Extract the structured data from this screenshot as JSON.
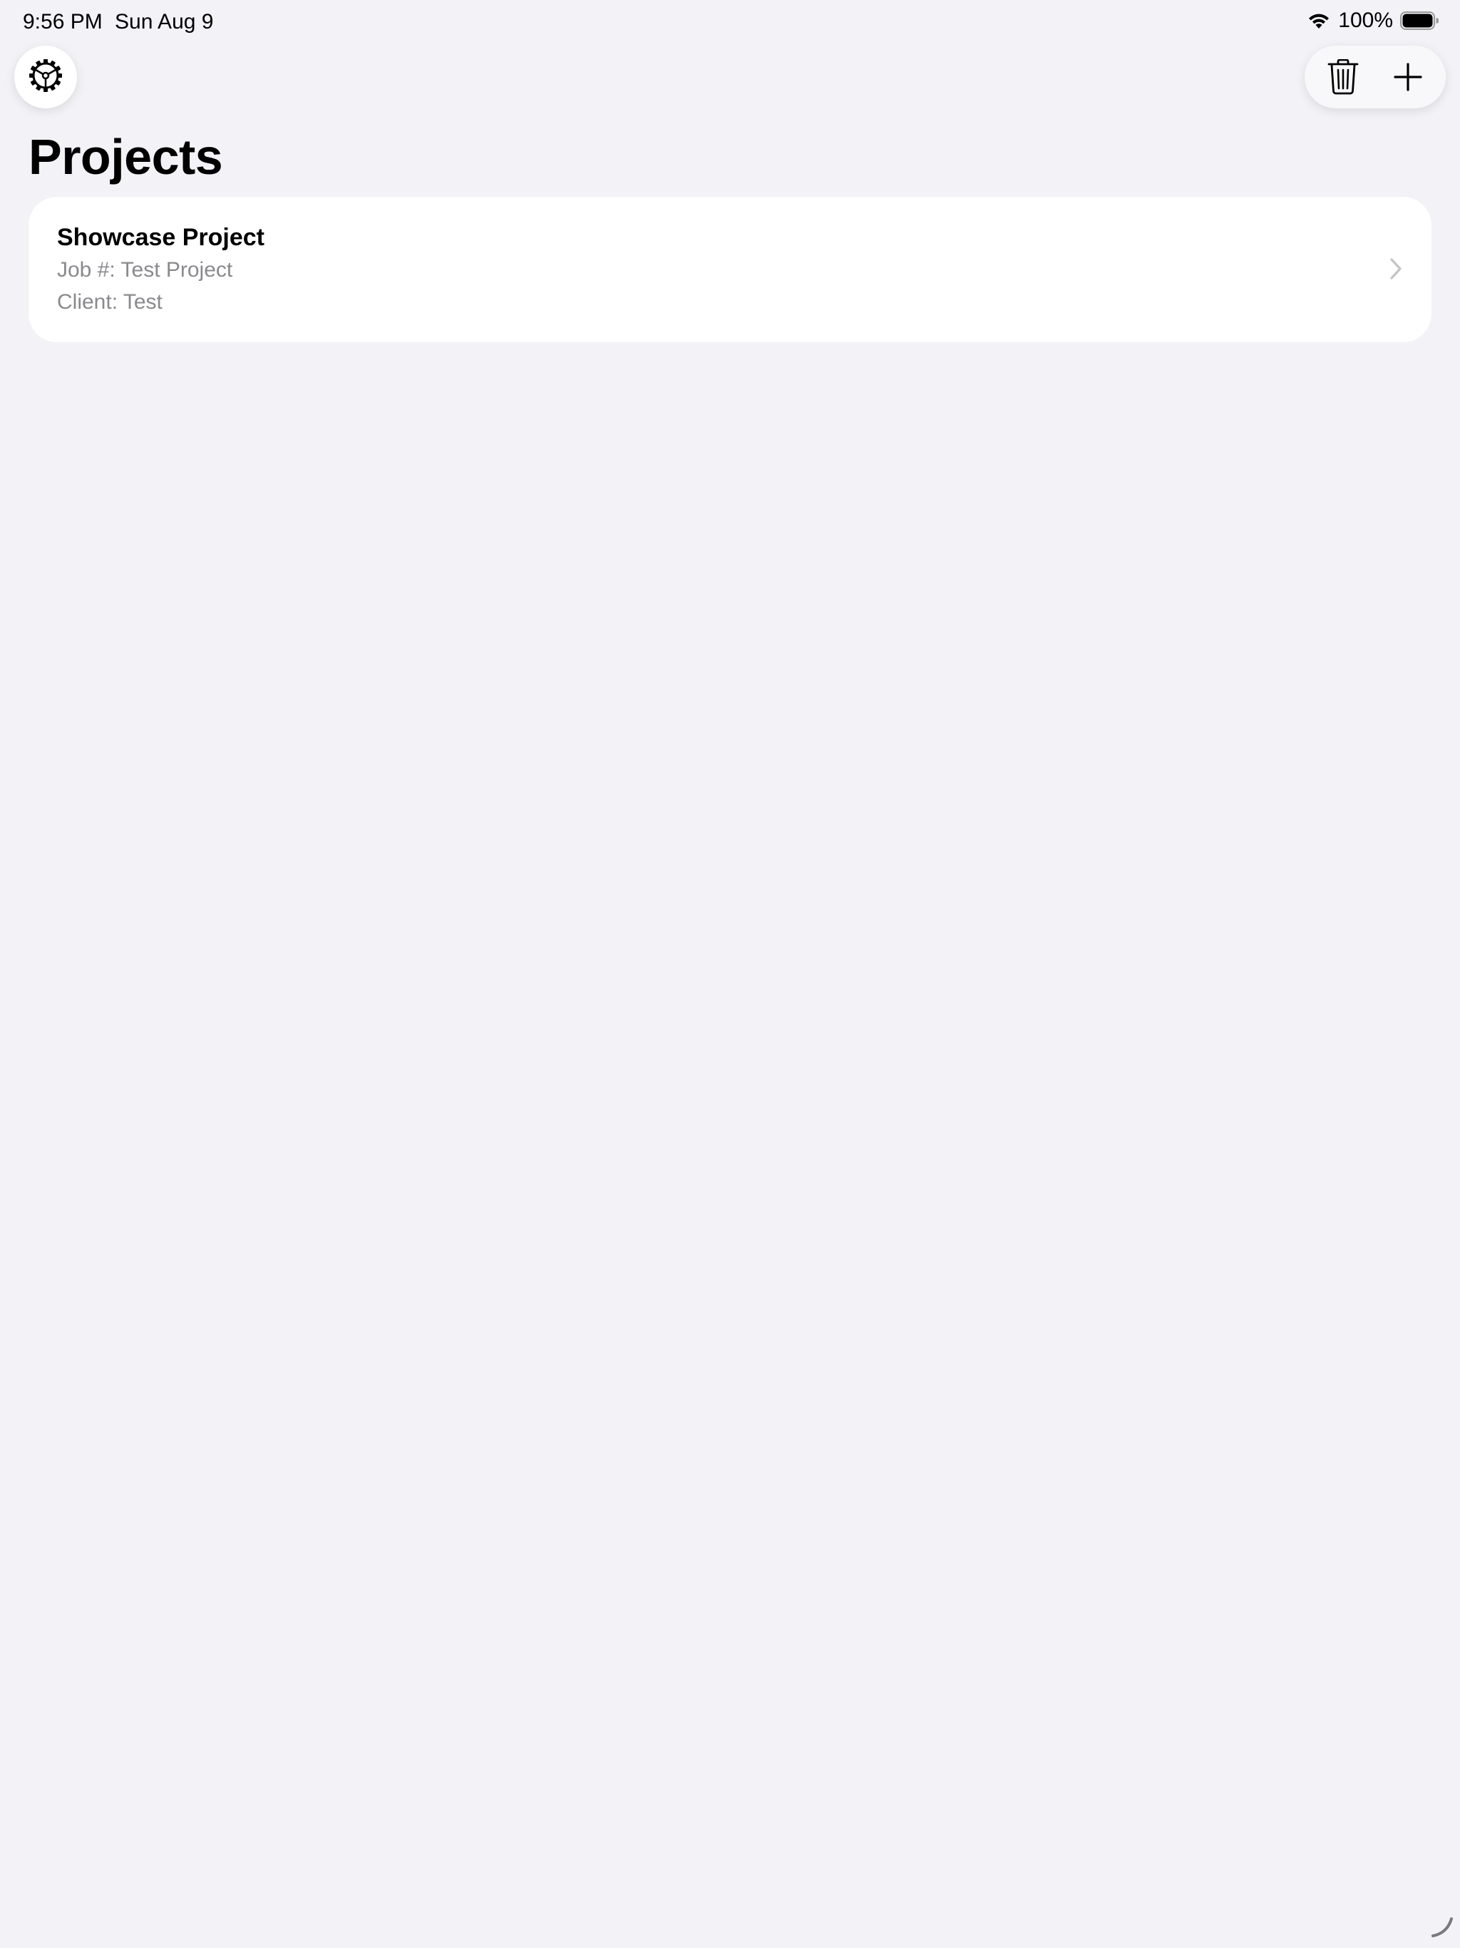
{
  "status_bar": {
    "time": "9:56 PM",
    "date": "Sun Aug 9",
    "battery_percent": "100%",
    "battery_level": 1.0,
    "icons": [
      "wifi-icon",
      "battery-icon"
    ]
  },
  "toolbar": {
    "settings_icon": "gear-icon",
    "delete_icon": "trash-icon",
    "add_icon": "plus-icon"
  },
  "page": {
    "title": "Projects"
  },
  "projects": [
    {
      "name": "Showcase Project",
      "job": "Job #: Test Project",
      "client": "Client: Test",
      "icon": "chevron-right-icon"
    }
  ],
  "colors": {
    "background": "#f2f2f7",
    "card": "#ffffff",
    "secondary_text": "#8a8a8e",
    "chevron": "#c4c4c7"
  }
}
